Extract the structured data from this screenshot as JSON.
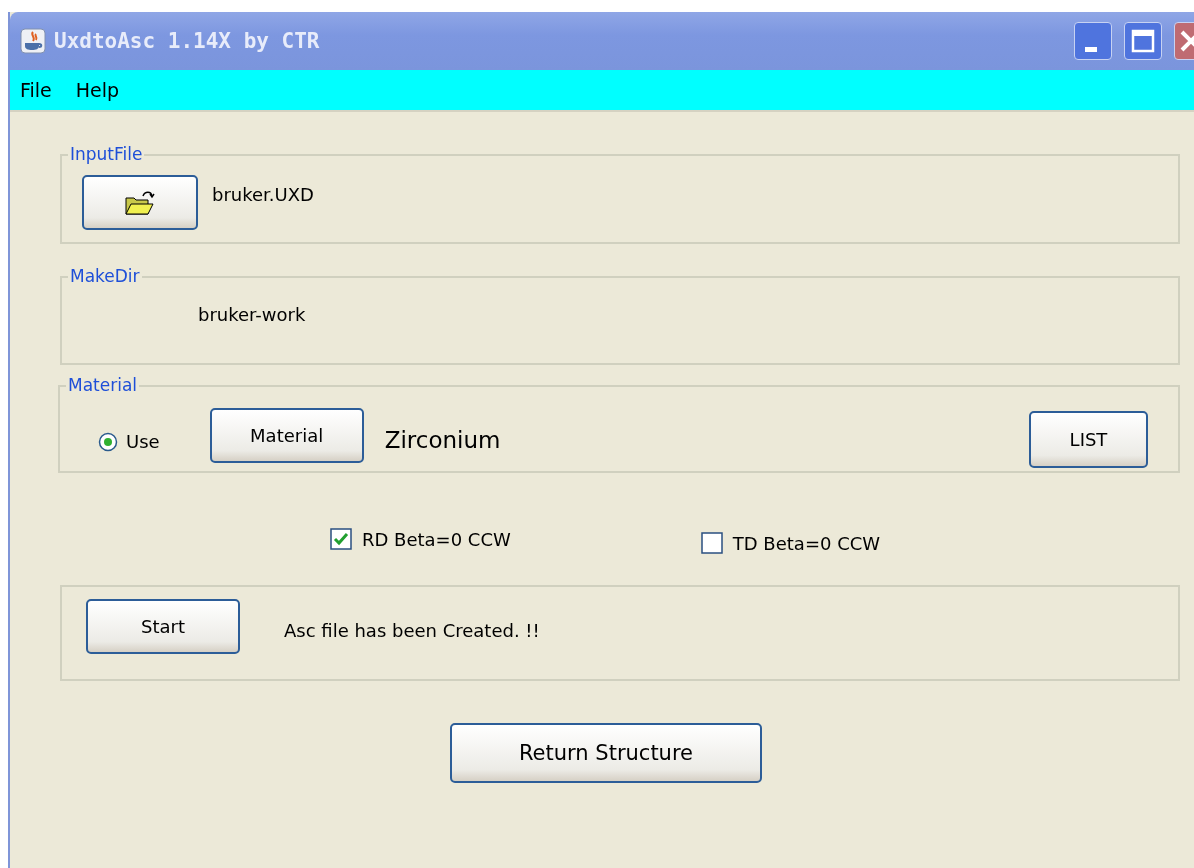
{
  "window": {
    "title": "UxdtoAsc 1.14X by CTR"
  },
  "menu": [
    "File",
    "Help"
  ],
  "input_file": {
    "legend": "InputFile",
    "file_name": "bruker.UXD"
  },
  "make_dir": {
    "legend": "MakeDir",
    "value": "bruker-work"
  },
  "material": {
    "legend": "Material",
    "use_radio": {
      "label": "Use",
      "selected": true
    },
    "material_button": "Material",
    "value": "Zirconium",
    "list_button": "LIST"
  },
  "options": [
    {
      "label": "RD Beta=0 CCW",
      "checked": true
    },
    {
      "label": "TD Beta=0 CCW",
      "checked": false
    }
  ],
  "start": {
    "button": "Start",
    "status": "Asc file has been Created. !!"
  },
  "return_button": "Return Structure"
}
